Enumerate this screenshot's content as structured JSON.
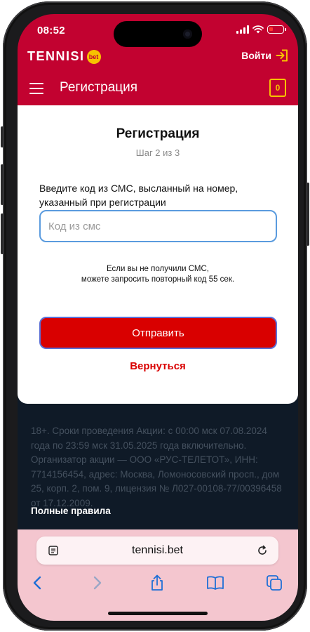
{
  "status_bar": {
    "time": "08:52"
  },
  "header": {
    "logo_text": "TENNISI",
    "logo_badge": "bet",
    "login_label": "Войти",
    "page_title": "Регистрация",
    "coupon_count": "0"
  },
  "card": {
    "title": "Регистрация",
    "step": "Шаг 2 из 3",
    "label": "Введите код из СМС, высланный на номер, указанный при регистрации",
    "sms_placeholder": "Код из смс",
    "sms_value": "",
    "hint_line1": "Если вы не получили СМС,",
    "hint_line2": "можете запросить повторный код 55 сек.",
    "submit_label": "Отправить",
    "back_label": "Вернуться"
  },
  "legal": {
    "text": "18+. Сроки проведения Акции: с 00:00 мск 07.08.2024 года по 23:59 мск 31.05.2025 года включительно. Организатор акции — ООО «РУС-ТЕЛЕТОТ», ИНН: 7714156454, адрес: Москва, Ломоносовский просп., дом 25, корп. 2, пом. 9, лицензия № Л027-00108-77/00396458 от 17.12.2009.",
    "rules_link": "Полные правила"
  },
  "browser": {
    "url": "tennisi.bet",
    "toolbar": [
      "back-icon",
      "forward-icon",
      "share-icon",
      "bookmarks-icon",
      "tabs-icon"
    ]
  },
  "colors": {
    "brand_red": "#c20230",
    "button_red": "#d90000",
    "accent_yellow": "#f7c200",
    "dark_bg": "#0f1a27",
    "safari_bar": "#f4c6cf"
  }
}
